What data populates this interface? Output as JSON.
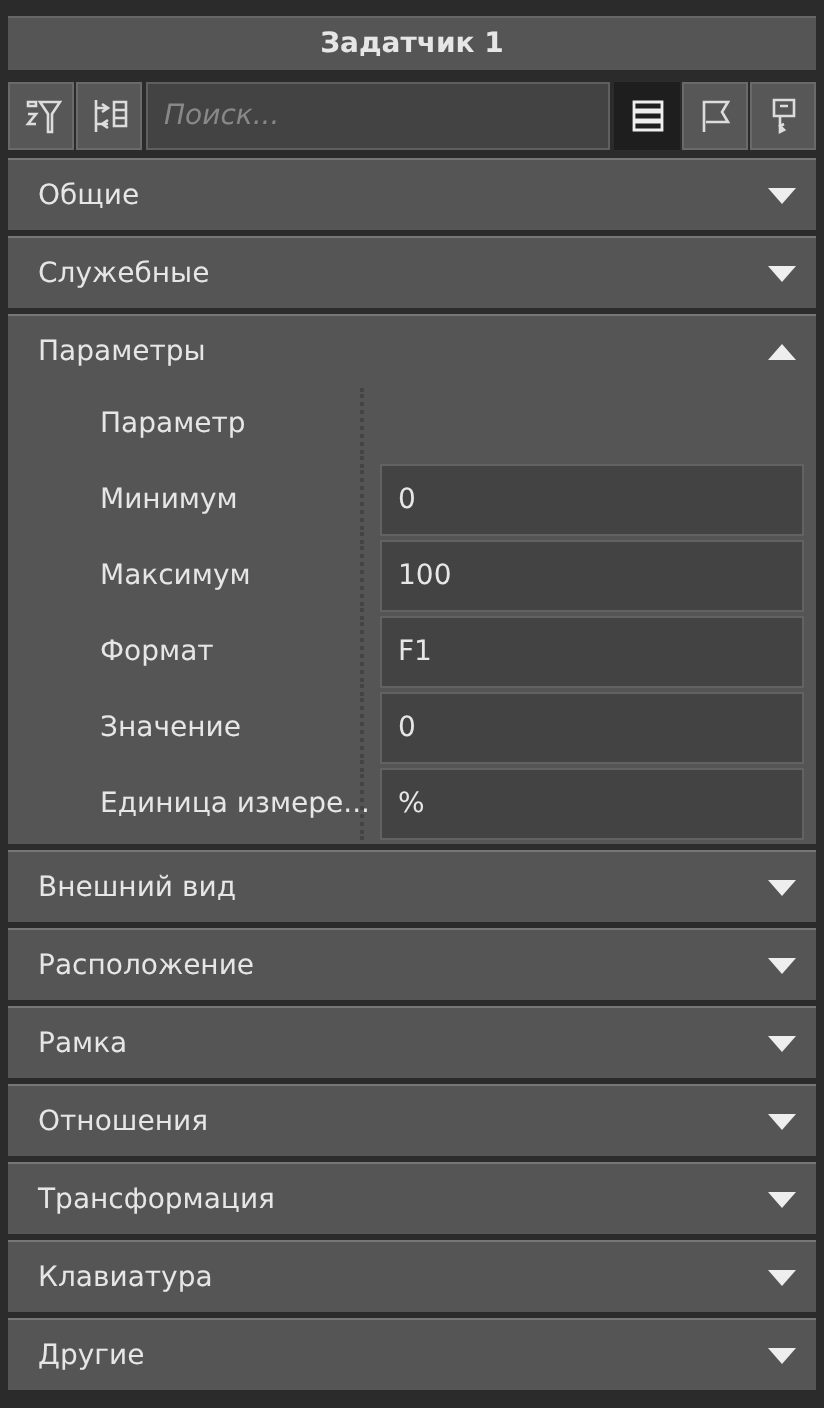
{
  "title": "Задатчик 1",
  "toolbar": {
    "tools": [
      {
        "kind": "sort-filter"
      },
      {
        "kind": "expand-collapse"
      }
    ],
    "search": {
      "placeholder": "Поиск..."
    },
    "views": [
      {
        "kind": "list",
        "selected": true
      },
      {
        "kind": "flag",
        "selected": false
      },
      {
        "kind": "key",
        "selected": false
      }
    ]
  },
  "sections": [
    {
      "label": "Общие",
      "expanded": false
    },
    {
      "label": "Служебные",
      "expanded": false
    },
    {
      "label": "Параметры",
      "expanded": true,
      "properties": [
        {
          "label": "Параметр"
        },
        {
          "label": "Минимум",
          "value": "0"
        },
        {
          "label": "Максимум",
          "value": "100"
        },
        {
          "label": "Формат",
          "value": "F1"
        },
        {
          "label": "Значение",
          "value": "0"
        },
        {
          "label": "Единица измере...",
          "value": "%"
        }
      ]
    },
    {
      "label": "Внешний вид",
      "expanded": false
    },
    {
      "label": "Расположение",
      "expanded": false
    },
    {
      "label": "Рамка",
      "expanded": false
    },
    {
      "label": "Отношения",
      "expanded": false
    },
    {
      "label": "Трансформация",
      "expanded": false
    },
    {
      "label": "Клавиатура",
      "expanded": false
    },
    {
      "label": "Другие",
      "expanded": false
    }
  ]
}
